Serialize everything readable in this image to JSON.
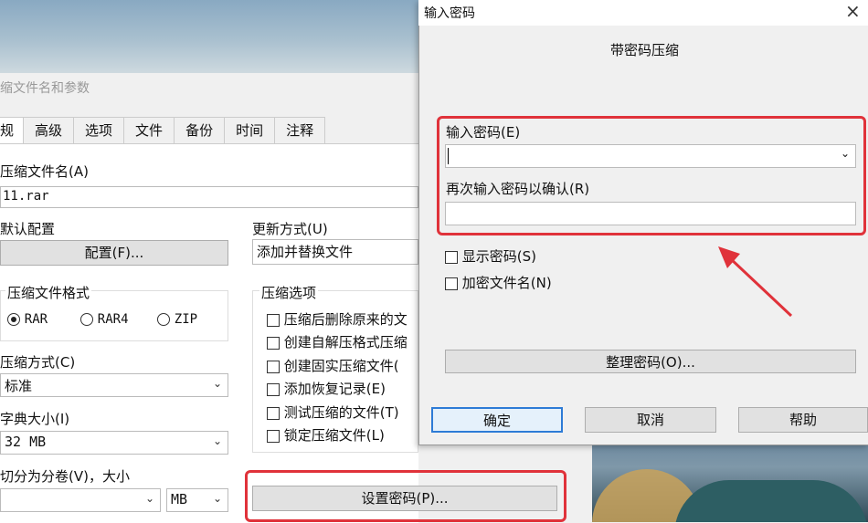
{
  "main": {
    "title": "缩文件名和参数",
    "tabs": [
      "规",
      "高级",
      "选项",
      "文件",
      "备份",
      "时间",
      "注释"
    ],
    "archive_name_label": "压缩文件名(A)",
    "archive_name_value": "11.rar",
    "default_profile_label": "默认配置",
    "profiles_button": "配置(F)...",
    "update_mode_label": "更新方式(U)",
    "update_mode_value": "添加并替换文件",
    "format_group_label": "压缩文件格式",
    "formats": [
      {
        "label": "RAR",
        "selected": true
      },
      {
        "label": "RAR4",
        "selected": false
      },
      {
        "label": "ZIP",
        "selected": false
      }
    ],
    "method_label": "压缩方式(C)",
    "method_value": "标准",
    "dict_label": "字典大小(I)",
    "dict_value": "32 MB",
    "split_label": "切分为分卷(V)，大小",
    "split_unit": "MB",
    "options_group_label": "压缩选项",
    "options": [
      "压缩后删除原来的文",
      "创建自解压格式压缩",
      "创建固实压缩文件(",
      "添加恢复记录(E)",
      "测试压缩的文件(T)",
      "锁定压缩文件(L)"
    ],
    "set_password_button": "设置密码(P)..."
  },
  "password_dialog": {
    "window_title": "输入密码",
    "heading": "带密码压缩",
    "enter_label": "输入密码(E)",
    "enter_value": "",
    "confirm_label": "再次输入密码以确认(R)",
    "confirm_value": "",
    "show_password": "显示密码(S)",
    "encrypt_names": "加密文件名(N)",
    "organize_button": "整理密码(O)...",
    "ok_button": "确定",
    "cancel_button": "取消",
    "help_button": "帮助"
  },
  "colors": {
    "highlight": "#e0323a",
    "focus": "#2d7bd6"
  }
}
